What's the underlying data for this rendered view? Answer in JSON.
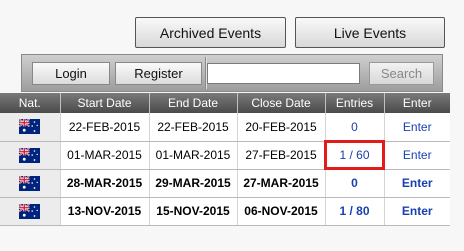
{
  "header": {
    "archived_label": "Archived Events",
    "live_label": "Live Events"
  },
  "login_bar": {
    "login_label": "Login",
    "register_label": "Register",
    "search_value": "",
    "search_label": "Search"
  },
  "table": {
    "columns": [
      "Nat.",
      "Start Date",
      "End Date",
      "Close Date",
      "Entries",
      "Enter"
    ],
    "rows": [
      {
        "nat": "australia-flag",
        "start": "22-FEB-2015",
        "end": "22-FEB-2015",
        "close": "20-FEB-2015",
        "entries": "0",
        "enter": "Enter",
        "bold": false
      },
      {
        "nat": "australia-flag",
        "start": "01-MAR-2015",
        "end": "01-MAR-2015",
        "close": "27-FEB-2015",
        "entries": "1 / 60",
        "enter": "Enter",
        "bold": false
      },
      {
        "nat": "australia-flag",
        "start": "28-MAR-2015",
        "end": "29-MAR-2015",
        "close": "27-MAR-2015",
        "entries": "0",
        "enter": "Enter",
        "bold": true
      },
      {
        "nat": "australia-flag",
        "start": "13-NOV-2015",
        "end": "15-NOV-2015",
        "close": "06-NOV-2015",
        "entries": "1 / 80",
        "enter": "Enter",
        "bold": true
      }
    ]
  },
  "colors": {
    "link": "#1a40b0",
    "highlight": "#e41b1b",
    "header_bg": "#4a4a4a"
  }
}
